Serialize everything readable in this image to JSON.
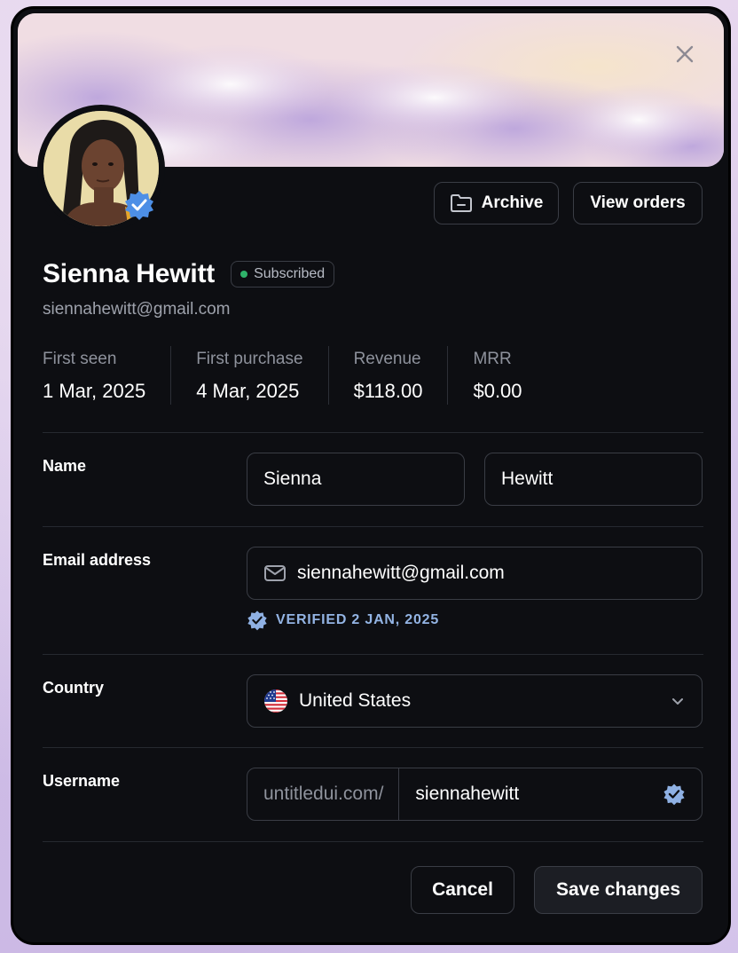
{
  "header": {
    "archive_label": "Archive",
    "view_orders_label": "View orders"
  },
  "profile": {
    "name": "Sienna Hewitt",
    "status_badge": "Subscribed",
    "email": "siennahewitt@gmail.com"
  },
  "stats": [
    {
      "label": "First seen",
      "value": "1 Mar, 2025"
    },
    {
      "label": "First purchase",
      "value": "4 Mar, 2025"
    },
    {
      "label": "Revenue",
      "value": "$118.00"
    },
    {
      "label": "MRR",
      "value": "$0.00"
    }
  ],
  "form": {
    "name_label": "Name",
    "first_name": "Sienna",
    "last_name": "Hewitt",
    "email_label": "Email address",
    "email_value": "siennahewitt@gmail.com",
    "verified_text": "VERIFIED 2 JAN, 2025",
    "country_label": "Country",
    "country_value": "United States",
    "username_label": "Username",
    "username_prefix": "untitledui.com/",
    "username_value": "siennahewitt"
  },
  "footer": {
    "cancel_label": "Cancel",
    "save_label": "Save changes"
  },
  "colors": {
    "background": "#0d0e12",
    "border": "#3a3d45",
    "verified_blue": "#4d8fe6",
    "status_green": "#2fb36a"
  },
  "icons": [
    "close-icon",
    "archive-folder-icon",
    "verified-icon",
    "mail-icon",
    "us-flag-icon",
    "chevron-down-icon"
  ]
}
